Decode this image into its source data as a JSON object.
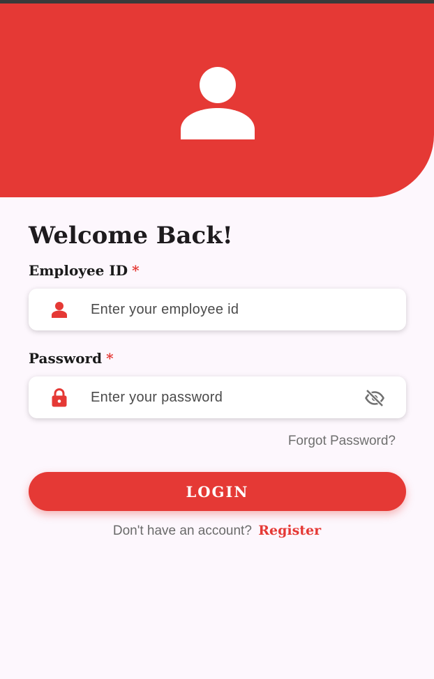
{
  "theme": {
    "primary": "#e53935",
    "background": "#fdf7fd"
  },
  "header": {
    "avatar_icon": "person-icon"
  },
  "welcome": {
    "title": "Welcome Back!"
  },
  "employee_id": {
    "label": "Employee ID",
    "required_mark": "*",
    "placeholder": "Enter your employee id",
    "value": "",
    "icon": "person-icon"
  },
  "password": {
    "label": "Password",
    "required_mark": "*",
    "placeholder": "Enter your password",
    "value": "",
    "icon": "lock-icon",
    "toggle_icon": "eye-off-icon"
  },
  "forgot_password": {
    "label": "Forgot Password?"
  },
  "login": {
    "label": "LOGIN"
  },
  "register": {
    "prompt": "Don't have an account?",
    "link": "Register"
  }
}
